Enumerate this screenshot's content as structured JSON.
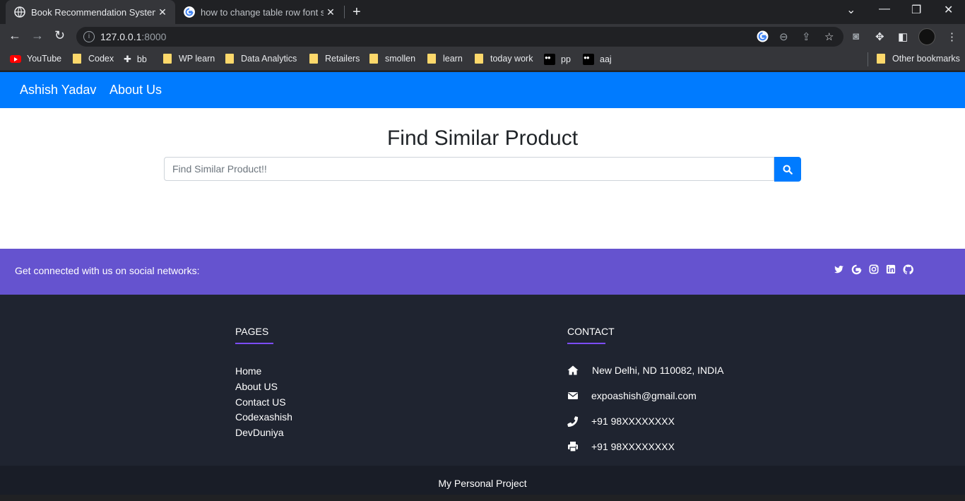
{
  "browser": {
    "tabs": [
      {
        "title": "Book Recommendation System",
        "active": true
      },
      {
        "title": "how to change table row font siz",
        "active": false
      }
    ],
    "url_host": "127.0.0.1",
    "url_port": ":8000",
    "bookmarks": [
      "YouTube",
      "Codex",
      "bb",
      "WP learn",
      "Data Analytics",
      "Retailers",
      "smollen",
      "learn",
      "today work",
      "pp",
      "aaj"
    ],
    "other_bookmarks": "Other bookmarks"
  },
  "navbar": {
    "brand": "Ashish Yadav",
    "about": "About Us",
    "color": "#007bff"
  },
  "main": {
    "heading": "Find Similar Product",
    "search_placeholder": "Find Similar Product!!"
  },
  "social": {
    "text": "Get connected with us on social networks:",
    "icons": [
      "twitter-icon",
      "google-icon",
      "instagram-icon",
      "linkedin-icon",
      "github-icon"
    ],
    "color": "#6553cf"
  },
  "footer": {
    "pages_heading": "PAGES",
    "pages": [
      "Home",
      "About US",
      "Contact US",
      "Codexashish",
      "DevDuniya"
    ],
    "contact_heading": "CONTACT",
    "address": "New Delhi, ND 110082, INDIA",
    "email": "expoashish@gmail.com",
    "phone": "+91 98XXXXXXXX",
    "fax": "+91 98XXXXXXXX",
    "copyright": "My Personal Project"
  }
}
